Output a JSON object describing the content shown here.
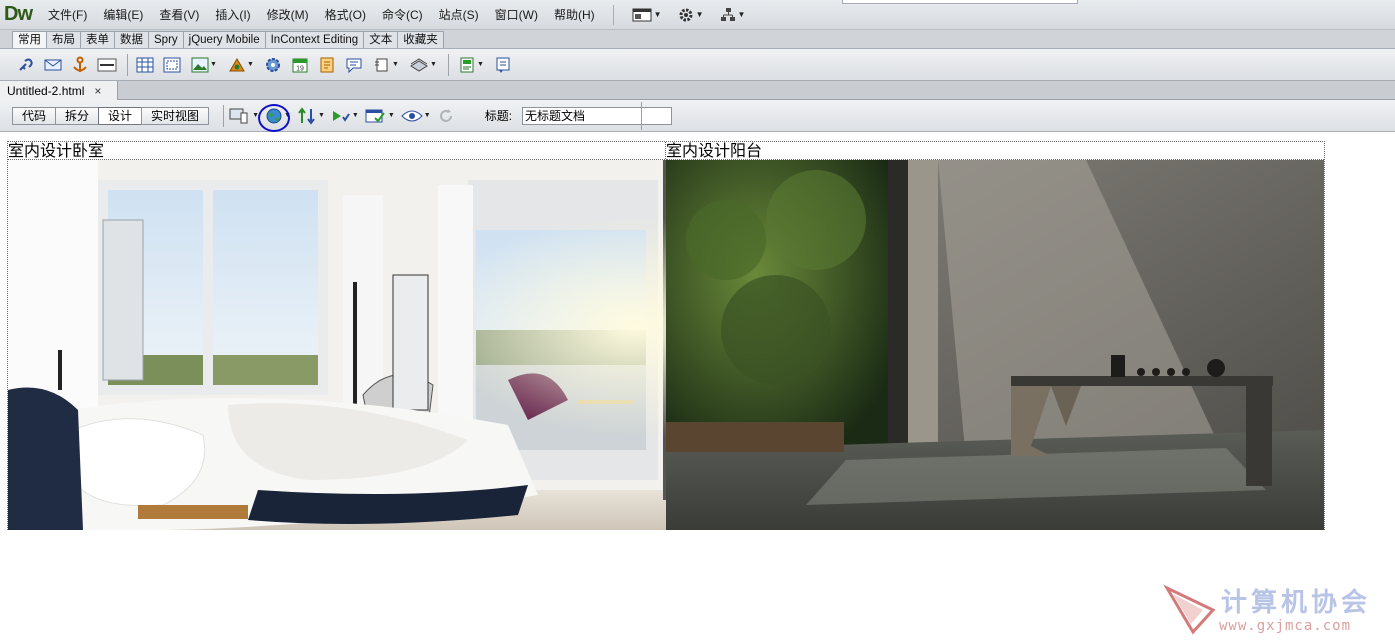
{
  "app": {
    "logo": "Dw"
  },
  "menu": {
    "items": [
      "文件(F)",
      "编辑(E)",
      "查看(V)",
      "插入(I)",
      "修改(M)",
      "格式(O)",
      "命令(C)",
      "站点(S)",
      "窗口(W)",
      "帮助(H)"
    ],
    "icons": [
      "layout-icon",
      "gear-icon",
      "site-icon"
    ]
  },
  "insert_tabs": {
    "items": [
      "常用",
      "布局",
      "表单",
      "数据",
      "Spry",
      "jQuery Mobile",
      "InContext Editing",
      "文本",
      "收藏夹"
    ],
    "active": "常用"
  },
  "document": {
    "tab_label": "Untitled-2.html",
    "close_glyph": "×"
  },
  "doc_toolbar": {
    "view_buttons": [
      "代码",
      "拆分",
      "设计",
      "实时视图"
    ],
    "active_view": "设计",
    "title_label": "标题:",
    "title_value": "无标题文档"
  },
  "content": {
    "left_caption": "室内设计卧室",
    "right_caption": "室内设计阳台"
  },
  "watermark": {
    "text": "计算机协会",
    "url": "www.gxjmca.com"
  },
  "colors": {
    "logo": "#2f5a16",
    "highlight_ring": "#1010c8",
    "watermark": "#b8c4e6"
  }
}
